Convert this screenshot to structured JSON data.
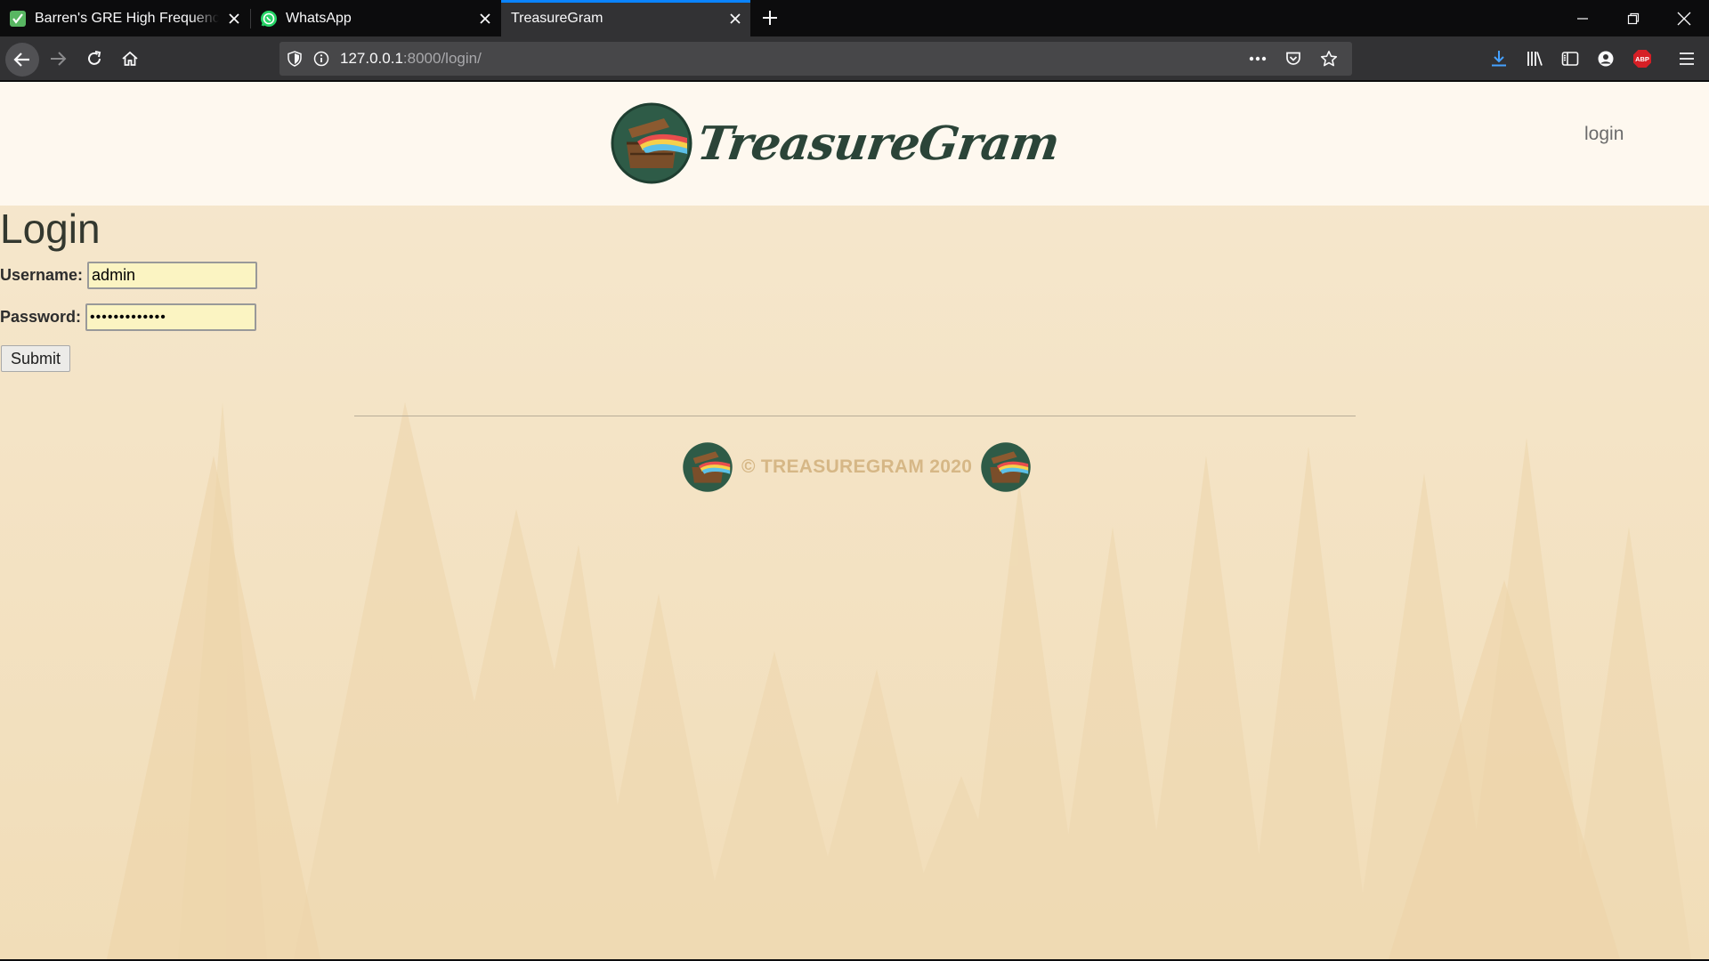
{
  "browser": {
    "tabs": [
      {
        "title": "Barren's GRE High Frequency W",
        "icon": "checkmark-favicon",
        "active": false
      },
      {
        "title": "WhatsApp",
        "icon": "whatsapp-favicon",
        "active": false
      },
      {
        "title": "TreasureGram",
        "icon": "",
        "active": true
      }
    ],
    "url_host": "127.0.0.1",
    "url_rest": ":8000/login/",
    "accent": "#0a84ff"
  },
  "site": {
    "brand": "TreasureGram",
    "nav_login": "login",
    "heading": "Login",
    "username_label": "Username:",
    "username_value": "admin",
    "password_label": "Password:",
    "password_value": "•••••••••••••",
    "submit_label": "Submit",
    "footer_text": "© TREASUREGRAM 2020",
    "colors": {
      "header_bg": "#fef8ef",
      "page_bg": "#f6e8cf",
      "brand": "#2b4438",
      "footer": "#d6b786"
    }
  }
}
